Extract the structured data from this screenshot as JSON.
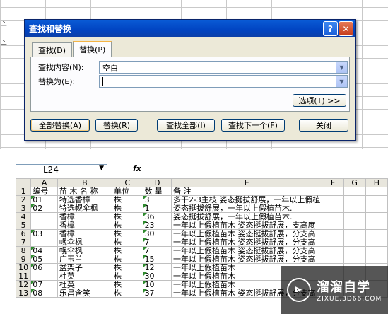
{
  "background": {
    "left_text_1": "主",
    "left_text_2": "主"
  },
  "dialog": {
    "title": "查找和替换",
    "help_label": "?",
    "close_label": "✕",
    "tabs": [
      {
        "label": "查找(D)"
      },
      {
        "label": "替换(P)"
      }
    ],
    "find_label": "查找内容(N):",
    "find_value": "空白",
    "replace_label": "替换为(E):",
    "replace_value": "",
    "options_button": "选项(T) >>",
    "buttons": {
      "replace_all": "全部替换(A)",
      "replace": "替换(R)",
      "find_all": "查找全部(I)",
      "find_next": "查找下一个(F)",
      "close": "关闭"
    }
  },
  "sheet": {
    "name_box": "L24",
    "fx_label": "fx",
    "columns": [
      "A",
      "B",
      "C",
      "D",
      "E",
      "F",
      "G",
      "H"
    ],
    "rows": [
      [
        "1",
        "编号",
        "苗 木 名 称",
        "单位",
        "数 量",
        "备  注"
      ],
      [
        "2",
        "01",
        "特选香樟",
        "株",
        "3",
        "多干2-3主枝 姿态挺拔舒展，一年以上假植"
      ],
      [
        "3",
        "02",
        "特选幌伞枫",
        "株",
        "1",
        "姿态挺拔舒展，一年以上假植苗木."
      ],
      [
        "4",
        "",
        "香樟",
        "株",
        "36",
        "姿态挺拔舒展，一年以上假植苗木."
      ],
      [
        "5",
        "",
        "香樟",
        "株",
        "23",
        "一年以上假植苗木 姿态挺拔舒展，支高度"
      ],
      [
        "6",
        "03",
        "香樟",
        "株",
        "30",
        "一年以上假植苗木 姿态挺拔舒展，分支高"
      ],
      [
        "7",
        "",
        "幌伞枫",
        "株",
        "7",
        "一年以上假植苗木 姿态挺拔舒展，分支高"
      ],
      [
        "8",
        "04",
        "幌伞枫",
        "株",
        "7",
        "一年以上假植苗木 姿态挺拔舒展，分支高"
      ],
      [
        "9",
        "05",
        "广玉兰",
        "株",
        "15",
        "一年以上假植苗木 姿态挺拔舒展，分支高"
      ],
      [
        "10",
        "06",
        "盆架子",
        "株",
        "12",
        "一年以上假植苗木"
      ],
      [
        "11",
        "",
        "杜英",
        "株",
        "30",
        "一年以上假植苗木"
      ],
      [
        "12",
        "07",
        "杜英",
        "株",
        "10",
        "一年以上假植苗木"
      ],
      [
        "13",
        "08",
        "乐昌含笑",
        "株",
        "37",
        "一年以上假植苗木 姿态挺拔舒展，分支高"
      ]
    ]
  },
  "watermark": {
    "main": "溜溜自学",
    "sub": "ZIXUE.3D66.COM"
  }
}
